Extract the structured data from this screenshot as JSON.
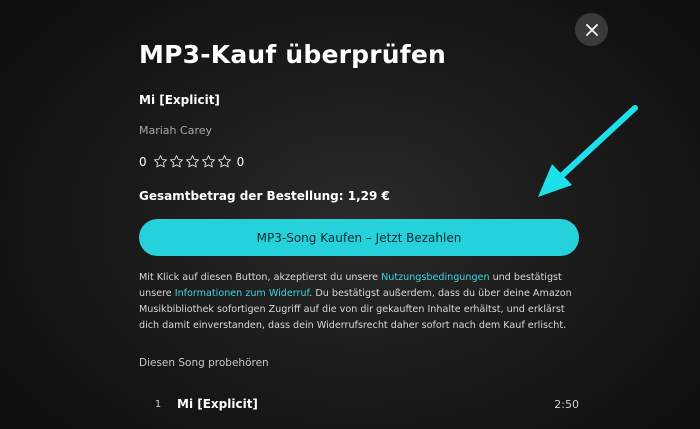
{
  "dialog": {
    "title": "MP3-Kauf überprüfen",
    "song_title": "Mi [Explicit]",
    "artist": "Mariah Carey",
    "rating": {
      "left_count": "0",
      "right_count": "0",
      "stars": 5,
      "filled": 0
    },
    "total_label": "Gesamtbetrag der Bestellung: 1,29 €",
    "buy_button_label": "MP3-Song Kaufen – Jetzt Bezahlen",
    "legal": {
      "part1": "Mit Klick auf diesen Button, akzeptierst du unsere ",
      "link1": "Nutzungsbedingungen",
      "part2": " und bestätigst unsere ",
      "link2": "Informationen zum Widerruf",
      "part3": ". Du bestätigst außerdem, dass du über deine Amazon Musikbibliothek sofortigen Zugriff auf die von dir gekauften Inhalte erhältst, und erklärst dich damit einverstanden, dass dein Widerrufsrecht daher sofort nach dem Kauf erlischt."
    },
    "preview_label": "Diesen Song probehören",
    "tracks": [
      {
        "number": "1",
        "title": "Mi [Explicit]",
        "duration": "2:50"
      }
    ]
  },
  "colors": {
    "accent": "#25d1da",
    "link": "#3fd5de",
    "arrow": "#1ee0ea"
  },
  "icons": {
    "close": "close-icon",
    "star": "star-outline-icon",
    "arrow": "pointer-arrow-annotation"
  }
}
